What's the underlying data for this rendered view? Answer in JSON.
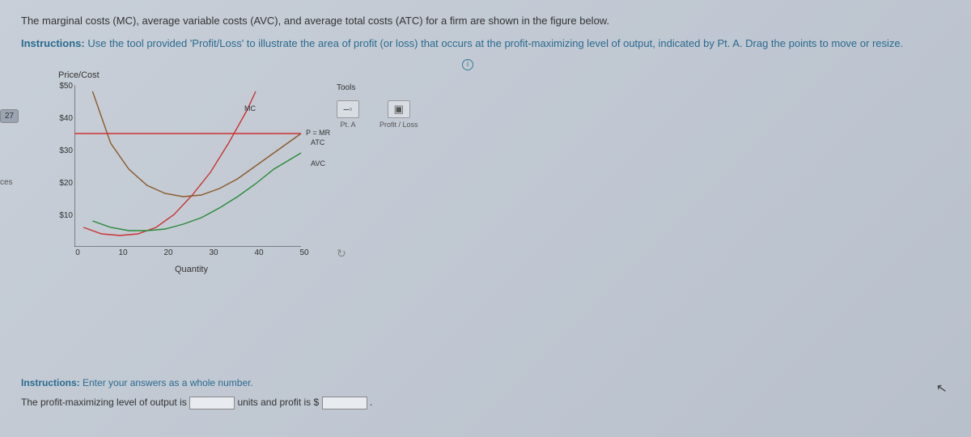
{
  "left_nav": {
    "number": "27",
    "label": "ces"
  },
  "question": "The marginal costs (MC), average variable costs (AVC), and average total costs (ATC) for a firm are shown in the figure below.",
  "instructions_prefix": "Instructions:",
  "instructions_body": " Use the tool provided 'Profit/Loss' to illustrate the area of profit (or loss) that occurs at the profit-maximizing level of output, indicated by Pt. A. Drag the points to move or resize.",
  "chart_data": {
    "type": "line",
    "title": "Price/Cost",
    "xlabel": "Quantity",
    "ylabel": "",
    "xlim": [
      0,
      50
    ],
    "ylim": [
      0,
      50
    ],
    "x_ticks": [
      "0",
      "10",
      "20",
      "30",
      "40",
      "50"
    ],
    "y_ticks": [
      "$10",
      "$20",
      "$30",
      "$40",
      "$50"
    ],
    "series": [
      {
        "name": "MC",
        "color": "#c33",
        "x": [
          2,
          6,
          10,
          14,
          18,
          22,
          26,
          30,
          34,
          38,
          40
        ],
        "values": [
          6,
          4,
          3.5,
          4,
          6,
          10,
          16,
          23,
          32,
          42,
          48
        ]
      },
      {
        "name": "ATC",
        "color": "#8a5a2a",
        "x": [
          4,
          8,
          12,
          16,
          20,
          24,
          28,
          32,
          36,
          40,
          44,
          50
        ],
        "values": [
          48,
          32,
          24,
          19,
          16.5,
          15.5,
          16,
          18,
          21,
          25,
          29,
          35
        ]
      },
      {
        "name": "AVC",
        "color": "#2a8a3a",
        "x": [
          4,
          8,
          12,
          16,
          20,
          24,
          28,
          32,
          36,
          40,
          44,
          50
        ],
        "values": [
          8,
          6,
          5,
          5,
          5.5,
          7,
          9,
          12,
          15.5,
          19.5,
          24,
          29
        ]
      },
      {
        "name": "P = MR",
        "color": "#c33",
        "x": [
          0,
          50
        ],
        "values": [
          35,
          35
        ]
      }
    ],
    "curve_labels": {
      "mc": "MC",
      "pmr": "P = MR",
      "atc": "ATC",
      "avc": "AVC"
    }
  },
  "tools": {
    "title": "Tools",
    "pta": "Pt. A",
    "profit_loss": "Profit / Loss"
  },
  "bottom": {
    "instr_prefix": "Instructions:",
    "instr_body": " Enter your answers as a whole number.",
    "line_a": "The profit-maximizing level of output is ",
    "line_b": " units and profit is $ ",
    "line_c": " ."
  }
}
